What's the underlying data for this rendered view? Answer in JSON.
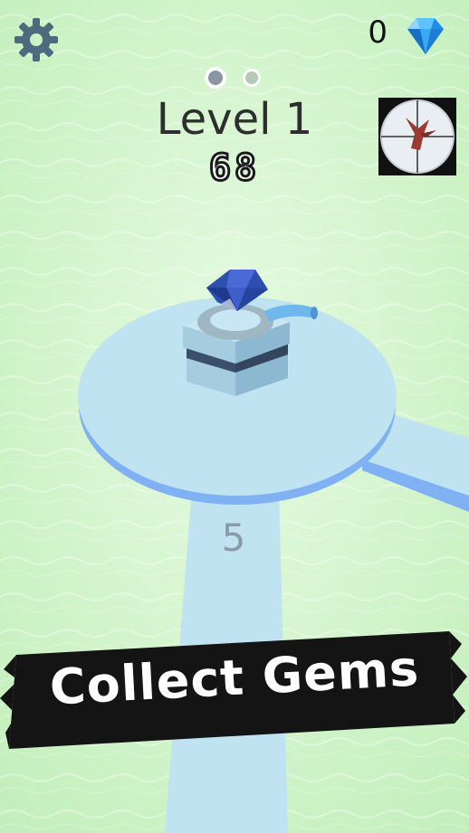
{
  "header": {
    "gem_count": "0",
    "level_title": "Level 1",
    "score": "68",
    "pages_total": 2,
    "page_active": 1
  },
  "board": {
    "path_number": "5"
  },
  "banner": {
    "text": "Collect Gems"
  },
  "colors": {
    "water": "#cdf2c6",
    "platform": "#bfe3f1",
    "platform_edge": "#7fb1f3",
    "gem": "#2f4fb0",
    "banner": "#141414"
  },
  "icons": {
    "settings": "gear-icon",
    "currency": "diamond-icon",
    "target": "crosshair-bird-icon"
  }
}
